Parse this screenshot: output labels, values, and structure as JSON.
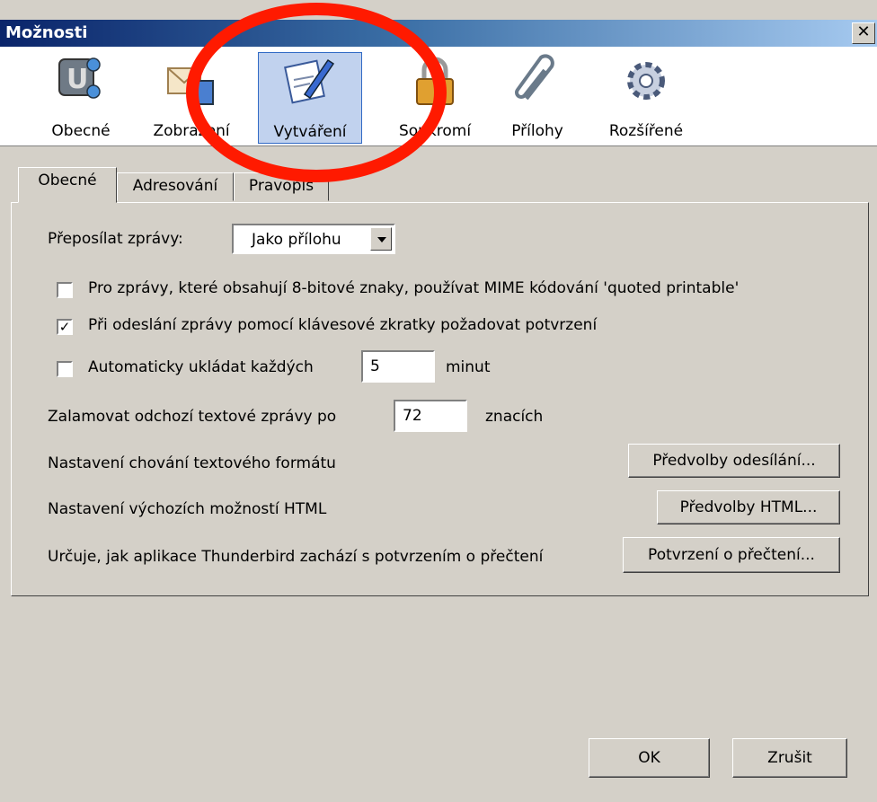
{
  "window": {
    "title": "Možnosti",
    "close": "✕"
  },
  "toolbar": {
    "items": [
      {
        "label": "Obecné",
        "icon": "general-icon"
      },
      {
        "label": "Zobrazení",
        "icon": "display-icon"
      },
      {
        "label": "Vytváření",
        "icon": "composition-icon",
        "selected": true
      },
      {
        "label": "Soukromí",
        "icon": "privacy-icon"
      },
      {
        "label": "Přílohy",
        "icon": "attachments-icon"
      },
      {
        "label": "Rozšířené",
        "icon": "advanced-icon"
      }
    ]
  },
  "tabs": [
    "Obecné",
    "Adresování",
    "Pravopis"
  ],
  "general": {
    "forward_label": "Přeposílat zprávy:",
    "forward_value": "Jako přílohu",
    "qp_label": "Pro zprávy, které obsahují 8-bitové znaky, používat MIME kódování 'quoted printable'",
    "qp_checked": false,
    "confirm_label": "Při odeslání zprávy pomocí klávesové zkratky požadovat potvrzení",
    "confirm_checked": true,
    "autosave_label": "Automaticky ukládat každých",
    "autosave_checked": false,
    "autosave_value": "5",
    "autosave_unit": "minut",
    "wrap_label": "Zalamovat odchozí textové zprávy po",
    "wrap_value": "72",
    "wrap_unit": "znacích",
    "text_format_label": "Nastavení chování textového formátu",
    "text_format_button": "Předvolby odesílání...",
    "html_label": "Nastavení výchozích možností HTML",
    "html_button": "Předvolby HTML...",
    "receipts_label": "Určuje, jak aplikace Thunderbird zachází s potvrzením o přečtení",
    "receipts_button": "Potvrzení o přečtení..."
  },
  "dialog": {
    "ok": "OK",
    "cancel": "Zrušit"
  },
  "colors": {
    "annotation": "#ff1a00",
    "title_bar": "#0a246a",
    "face": "#d4d0c8"
  }
}
